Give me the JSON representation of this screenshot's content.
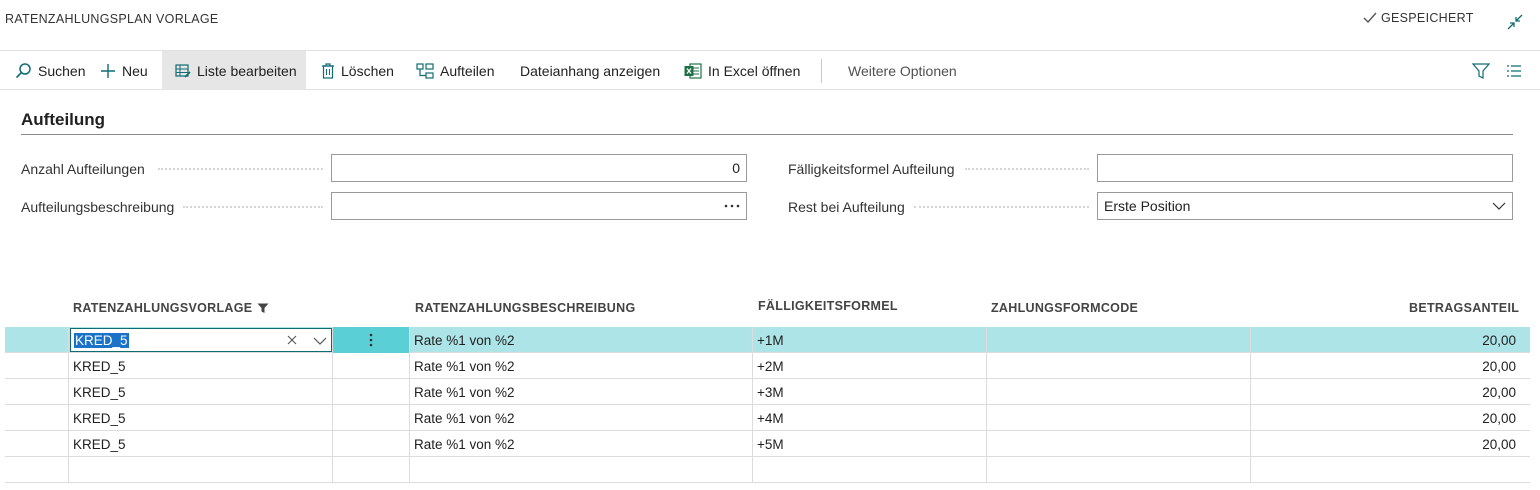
{
  "page": {
    "title": "RATENZAHLUNGSPLAN VORLAGE",
    "saved_status": "GESPEICHERT"
  },
  "toolbar": {
    "search": "Suchen",
    "new": "Neu",
    "edit_list": "Liste bearbeiten",
    "delete": "Löschen",
    "split": "Aufteilen",
    "show_attachment": "Dateianhang anzeigen",
    "open_excel": "In Excel öffnen",
    "more_options": "Weitere Optionen"
  },
  "section": {
    "title": "Aufteilung",
    "fields": {
      "num_splits_label": "Anzahl Aufteilungen",
      "num_splits_value": "0",
      "split_desc_label": "Aufteilungsbeschreibung",
      "split_desc_value": "",
      "due_formula_label": "Fälligkeitsformel Aufteilung",
      "due_formula_value": "",
      "remainder_label": "Rest bei Aufteilung",
      "remainder_value": "Erste Position"
    }
  },
  "grid": {
    "columns": {
      "template": "RATENZAHLUNGSVORLAGE",
      "description": "RATENZAHLUNGSBESCHREIBUNG",
      "due_formula": "FÄLLIGKEITSFORMEL",
      "payment_method": "ZAHLUNGSFORMCODE",
      "amount_share": "BETRAGSANTEIL"
    },
    "rows": [
      {
        "template": "KRED_5",
        "description": "Rate %1 von %2",
        "due_formula": "+1M",
        "payment_method": "",
        "amount_share": "20,00"
      },
      {
        "template": "KRED_5",
        "description": "Rate %1 von %2",
        "due_formula": "+2M",
        "payment_method": "",
        "amount_share": "20,00"
      },
      {
        "template": "KRED_5",
        "description": "Rate %1 von %2",
        "due_formula": "+3M",
        "payment_method": "",
        "amount_share": "20,00"
      },
      {
        "template": "KRED_5",
        "description": "Rate %1 von %2",
        "due_formula": "+4M",
        "payment_method": "",
        "amount_share": "20,00"
      },
      {
        "template": "KRED_5",
        "description": "Rate %1 von %2",
        "due_formula": "+5M",
        "payment_method": "",
        "amount_share": "20,00"
      }
    ]
  },
  "colors": {
    "selected_row": "#ace4e8",
    "selected_menu_cell": "#5bcfd6",
    "accent": "#0f6c75"
  }
}
